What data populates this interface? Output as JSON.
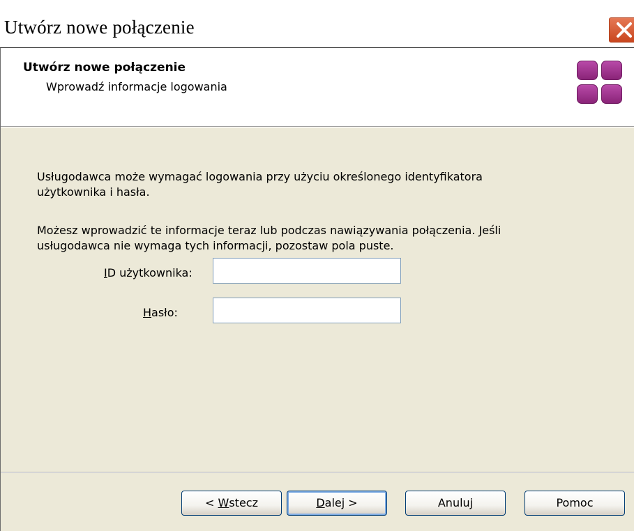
{
  "window": {
    "title": "Utwórz nowe połączenie",
    "close_icon": "close-icon"
  },
  "header": {
    "title": "Utwórz nowe połączenie",
    "subtitle": "Wprowadź informacje logowania",
    "logo_icon": "network-connections-icon",
    "logo_color": "#9b3590"
  },
  "content": {
    "paragraph1": "Usługodawca może wymagać logowania przy użyciu określonego identyfikatora użytkownika i hasła.",
    "paragraph2": "Możesz wprowadzić te informacje teraz lub podczas nawiązywania połączenia. Jeśli usługodawca nie wymaga tych informacji, pozostaw pola puste.",
    "user_id": {
      "label_access_key": "I",
      "label_rest": "D użytkownika:",
      "value": ""
    },
    "password": {
      "label_access_key": "H",
      "label_rest": "asło:",
      "value": ""
    }
  },
  "buttons": {
    "back": {
      "prefix": "< ",
      "access_key": "W",
      "rest": "stecz"
    },
    "next": {
      "access_key": "D",
      "rest": "alej >"
    },
    "cancel": "Anuluj",
    "help": "Pomoc"
  },
  "colors": {
    "panel_background": "#ece9d8",
    "textbox_border": "#7f9db9",
    "button_border": "#003c74",
    "close_button": "#d4562c"
  }
}
